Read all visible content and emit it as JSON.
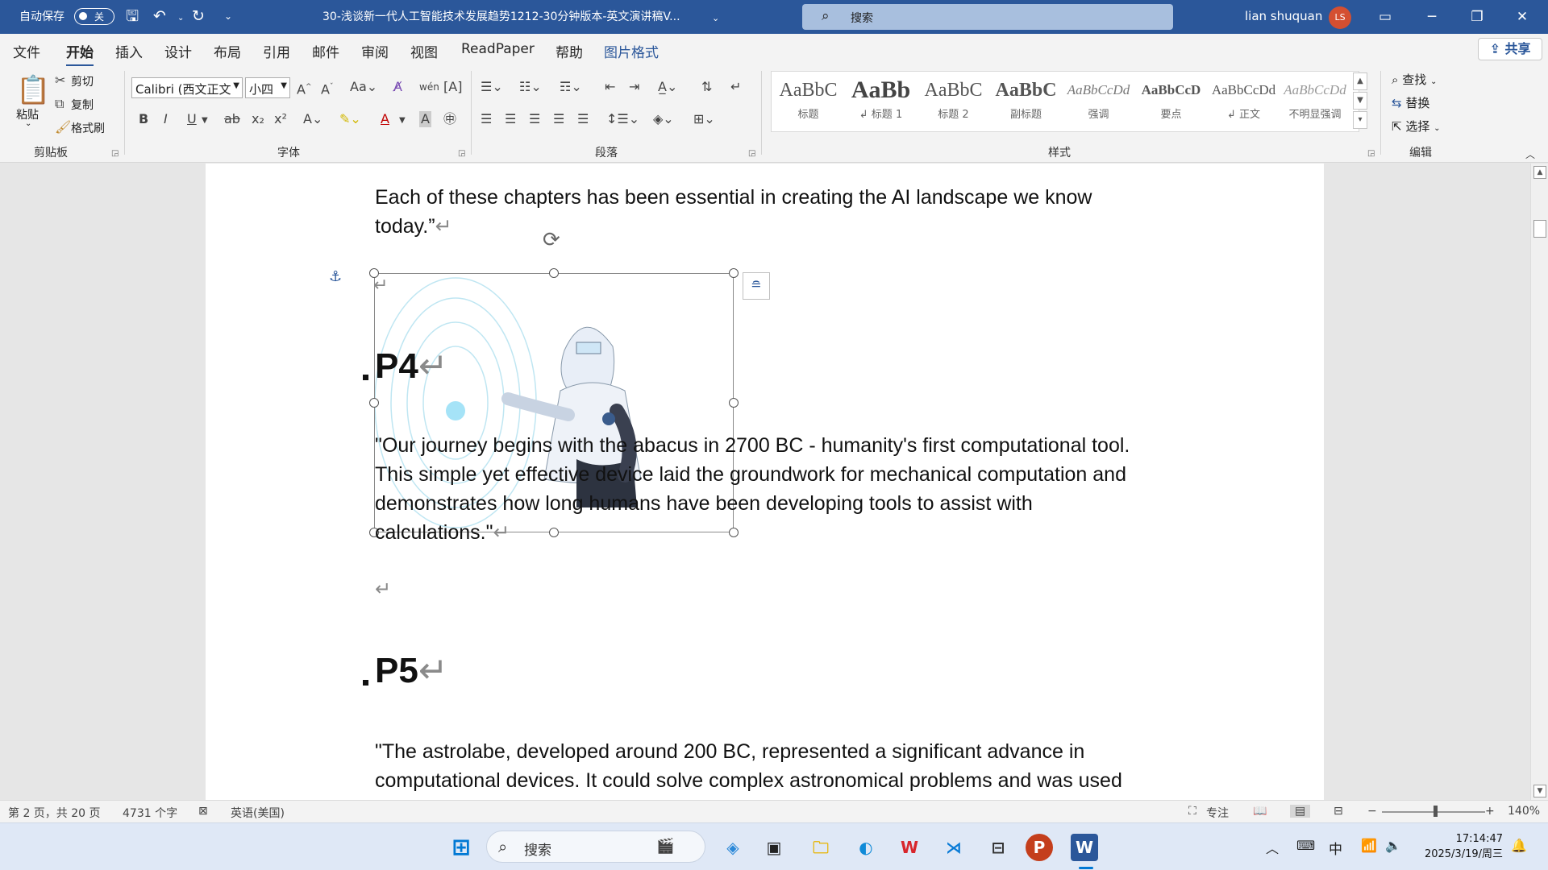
{
  "titlebar": {
    "autosave_label": "自动保存",
    "autosave_state": "关",
    "doc_title": "30-浅谈新一代人工智能技术发展趋势1212-30分钟版本-英文演讲稿V...",
    "search_placeholder": "搜索",
    "user_name": "lian shuquan",
    "avatar_initials": "LS"
  },
  "menus": [
    "文件",
    "开始",
    "插入",
    "设计",
    "布局",
    "引用",
    "邮件",
    "审阅",
    "视图",
    "ReadPaper",
    "帮助",
    "图片格式"
  ],
  "share_label": "共享",
  "ribbon": {
    "clipboard": {
      "paste": "粘贴",
      "cut": "剪切",
      "copy": "复制",
      "format_painter": "格式刷",
      "group": "剪贴板"
    },
    "font": {
      "name": "Calibri (西文正文",
      "size": "小四",
      "group": "字体"
    },
    "paragraph": {
      "group": "段落"
    },
    "styles": {
      "group": "样式",
      "items": [
        {
          "preview": "AaBbC",
          "name": "标题"
        },
        {
          "preview": "AaBb",
          "name": "↲ 标题 1"
        },
        {
          "preview": "AaBbC",
          "name": "标题 2"
        },
        {
          "preview": "AaBbC",
          "name": "副标题"
        },
        {
          "preview": "AaBbCcDd",
          "name": "强调"
        },
        {
          "preview": "AaBbCcD",
          "name": "要点"
        },
        {
          "preview": "AaBbCcDd",
          "name": "↲ 正文"
        },
        {
          "preview": "AaBbCcDd",
          "name": "不明显强调"
        }
      ]
    },
    "editing": {
      "find": "查找",
      "replace": "替换",
      "select": "选择",
      "group": "编辑"
    }
  },
  "document": {
    "para1": [
      "Each of these chapters has been essential in creating the AI landscape we know",
      "today.”"
    ],
    "heading_p4": "P4",
    "para2": [
      "\"Our journey begins with the abacus in 2700 BC - humanity's first computational tool.",
      "This simple yet effective device laid the groundwork for mechanical computation and",
      "demonstrates how long humans have been developing tools to assist with",
      "calculations.\""
    ],
    "heading_p5": "P5",
    "para3": [
      "\"The astrolabe, developed around 200 BC, represented a significant advance in",
      "computational devices. It could solve complex astronomical problems and was used"
    ],
    "return_mark": "↵"
  },
  "status": {
    "page": "第 2 页，共 20 页",
    "words": "4731 个字",
    "language": "英语(美国)",
    "focus": "专注",
    "zoom": "140%"
  },
  "taskbar": {
    "search_placeholder": "搜索",
    "ime": "中",
    "time": "17:14:47",
    "date": "2025/3/19/周三"
  },
  "colors": {
    "word_blue": "#2b579a",
    "accent_red": "#d44f31"
  }
}
